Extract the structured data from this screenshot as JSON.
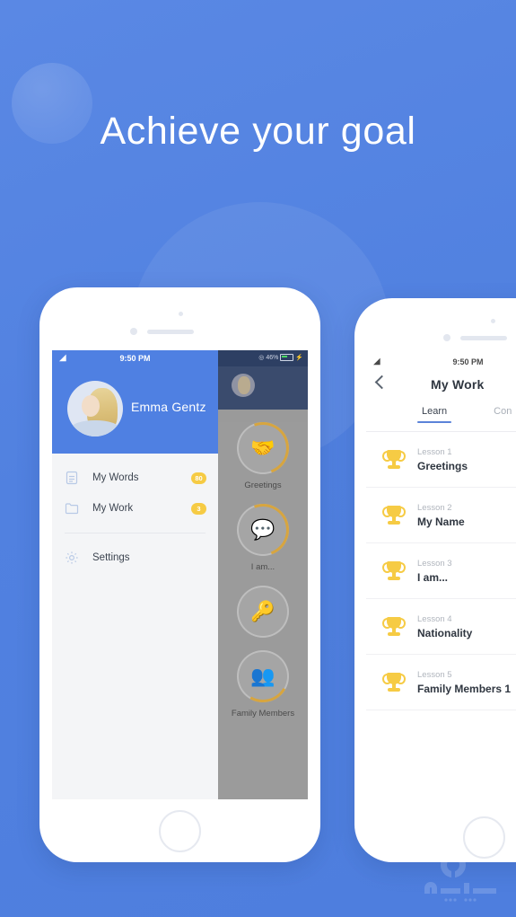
{
  "headline": "Achieve your goal",
  "theme": {
    "background_blue": "#5181e0",
    "accent_blue": "#4f80e2",
    "badge_yellow": "#f6cb44",
    "trophy_yellow": "#f6cb44",
    "tab_underline": "#5b83d9"
  },
  "phone_left": {
    "statusbar": {
      "time": "9:50 PM",
      "wifi_icon": "wifi-icon"
    },
    "dim_statusbar": {
      "battery_percent": "46%",
      "location_icon": "location-arrow-icon",
      "battery_icon": "battery-icon",
      "charging_icon": "bolt-icon"
    },
    "drawer": {
      "avatar_icon": "avatar",
      "user_name": "Emma Gentz",
      "items": [
        {
          "label": "My Words",
          "badge": "80",
          "icon": "note-icon"
        },
        {
          "label": "My Work",
          "badge": "3",
          "icon": "folder-icon"
        },
        {
          "label": "Settings",
          "badge": "",
          "icon": "gear-icon"
        }
      ]
    },
    "dim_panel": {
      "tiles": [
        {
          "label": "Greetings",
          "glyph": "🤝",
          "icon": "handshake-icon"
        },
        {
          "label": "I am...",
          "glyph": "💬",
          "icon": "speech-bubble-icon"
        },
        {
          "label": "",
          "glyph": "🔑",
          "icon": "key-icon"
        },
        {
          "label": "Family Members",
          "glyph": "👥",
          "icon": "people-icon"
        }
      ]
    }
  },
  "phone_right": {
    "statusbar": {
      "time": "9:50 PM",
      "wifi_icon": "wifi-icon"
    },
    "back_icon": "back-chevron-icon",
    "title": "My Work",
    "tabs": [
      {
        "label": "Learn",
        "active": true
      },
      {
        "label": "Con",
        "active": false
      }
    ],
    "lessons": [
      {
        "number": "Lesson 1",
        "title": "Greetings",
        "icon": "trophy-icon"
      },
      {
        "number": "Lesson 2",
        "title": "My Name",
        "icon": "trophy-icon"
      },
      {
        "number": "Lesson 3",
        "title": "I am...",
        "icon": "trophy-icon"
      },
      {
        "number": "Lesson 4",
        "title": "Nationality",
        "icon": "trophy-icon"
      },
      {
        "number": "Lesson 5",
        "title": "Family Members 1",
        "icon": "trophy-icon"
      }
    ]
  },
  "watermark": {
    "icon": "site-logo-watermark"
  }
}
